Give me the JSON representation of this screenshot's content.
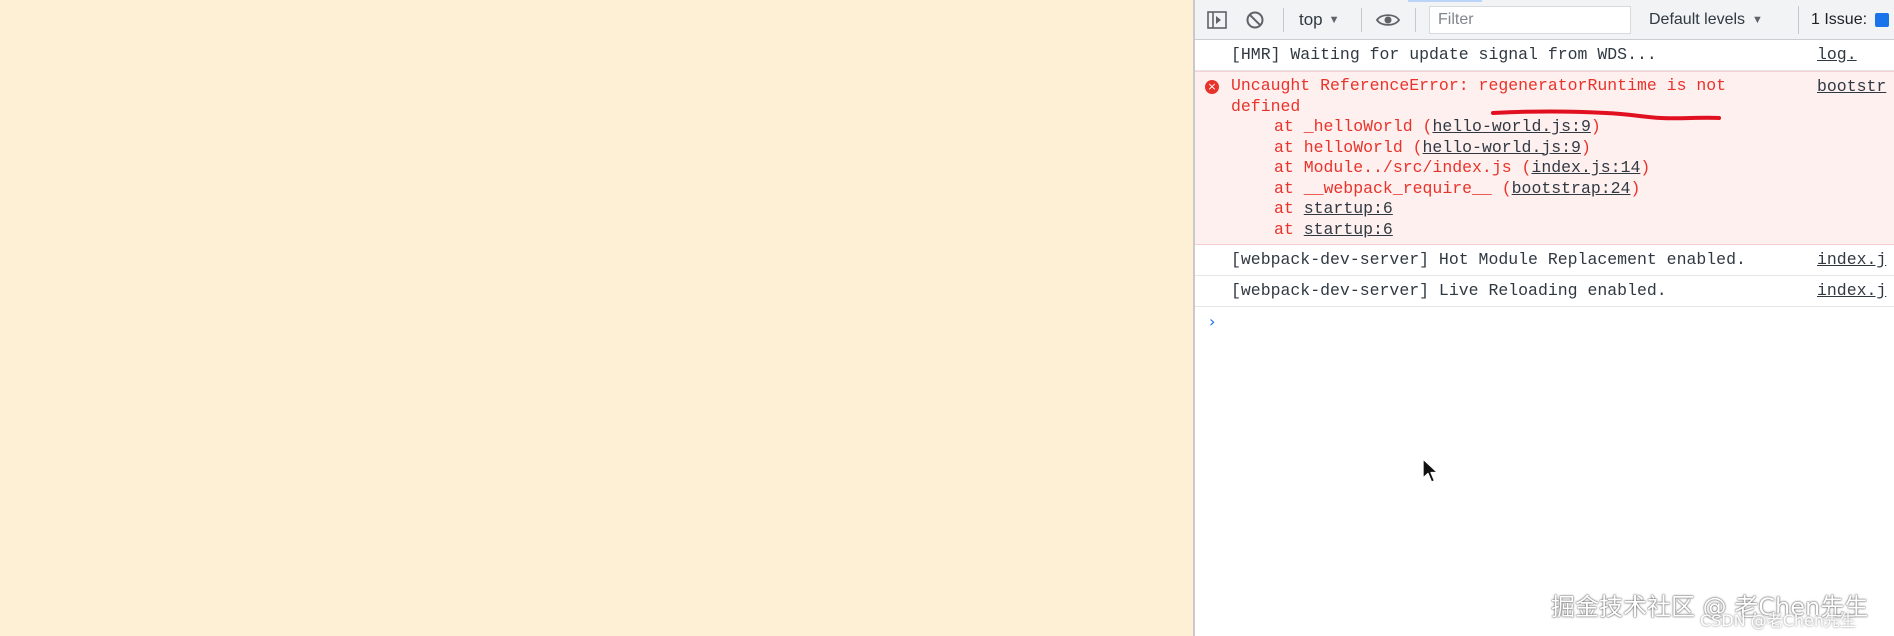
{
  "toolbar": {
    "sidebar_icon": "sidebar-toggle-icon",
    "clear_icon": "clear-console-icon",
    "context": "top",
    "eye_icon": "eye-icon",
    "filter_placeholder": "Filter",
    "levels": "Default levels",
    "issues": "1 Issue:"
  },
  "console": {
    "messages": [
      {
        "text": "[HMR] Waiting for update signal from WDS...",
        "source": "log."
      },
      {
        "level": "error",
        "text": "Uncaught ReferenceError: regeneratorRuntime is not defined",
        "source": "bootstr",
        "stack": [
          {
            "fn": "at _helloWorld (",
            "link": "hello-world.js:9",
            "end": ")"
          },
          {
            "fn": "at helloWorld (",
            "link": "hello-world.js:9",
            "end": ")"
          },
          {
            "fn": "at Module../src/index.js (",
            "link": "index.js:14",
            "end": ")"
          },
          {
            "fn": "at __webpack_require__ (",
            "link": "bootstrap:24",
            "end": ")"
          },
          {
            "fn": "at ",
            "link": "startup:6",
            "end": ""
          },
          {
            "fn": "at ",
            "link": "startup:6",
            "end": ""
          }
        ]
      },
      {
        "text": "[webpack-dev-server] Hot Module Replacement enabled.",
        "source": "index.j"
      },
      {
        "text": "[webpack-dev-server] Live Reloading enabled.",
        "source": "index.j"
      }
    ],
    "prompt": "›"
  },
  "watermark": {
    "main": "掘金技术社区 @ 老Chen先生",
    "sub": "CSDN @老Chen先生"
  },
  "colors": {
    "page_background": "#fdf0d5",
    "error_text": "#e8332a",
    "error_background": "#fff0f0",
    "annotation_red": "#e01020"
  }
}
